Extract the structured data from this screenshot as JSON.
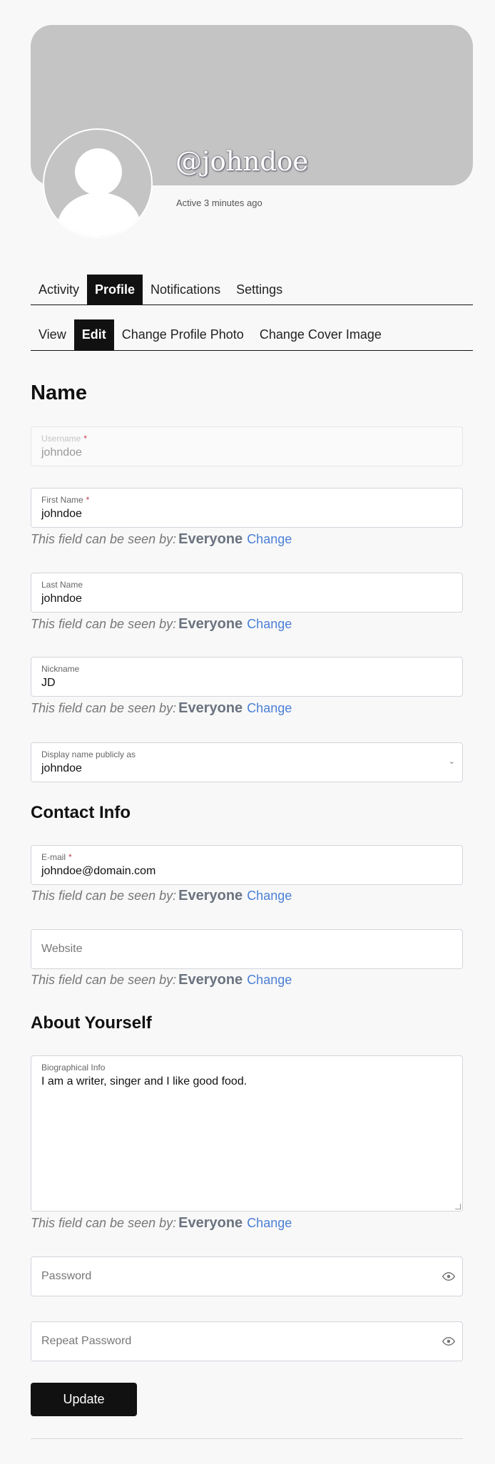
{
  "profile": {
    "handle": "@johndoe",
    "active": "Active 3 minutes ago"
  },
  "main_tabs": [
    {
      "label": "Activity",
      "selected": false
    },
    {
      "label": "Profile",
      "selected": true
    },
    {
      "label": "Notifications",
      "selected": false
    },
    {
      "label": "Settings",
      "selected": false
    }
  ],
  "sub_tabs": [
    {
      "label": "View",
      "selected": false
    },
    {
      "label": "Edit",
      "selected": true
    },
    {
      "label": "Change Profile Photo",
      "selected": false
    },
    {
      "label": "Change Cover Image",
      "selected": false
    }
  ],
  "sections": {
    "name": "Name",
    "contact": "Contact Info",
    "about": "About Yourself"
  },
  "fields": {
    "username": {
      "label": "Username",
      "required": "*",
      "value": "johndoe",
      "disabled": true
    },
    "first_name": {
      "label": "First Name",
      "required": "*",
      "value": "johndoe"
    },
    "last_name": {
      "label": "Last Name",
      "value": "johndoe"
    },
    "nickname": {
      "label": "Nickname",
      "value": "JD"
    },
    "display_name": {
      "label": "Display name publicly as",
      "value": "johndoe"
    },
    "email": {
      "label": "E-mail",
      "required": "*",
      "value": "johndoe@domain.com"
    },
    "website": {
      "placeholder": "Website"
    },
    "bio": {
      "label": "Biographical Info",
      "value": "I am a writer, singer and I like good food."
    },
    "password": {
      "placeholder": "Password"
    },
    "repeat_password": {
      "placeholder": "Repeat Password"
    }
  },
  "visibility": {
    "prefix": "This field can be seen by:",
    "level": "Everyone",
    "change": "Change"
  },
  "update_label": "Update",
  "colors": {
    "accent": "#111111",
    "link": "#4a7fd6",
    "required": "#c0394a"
  }
}
